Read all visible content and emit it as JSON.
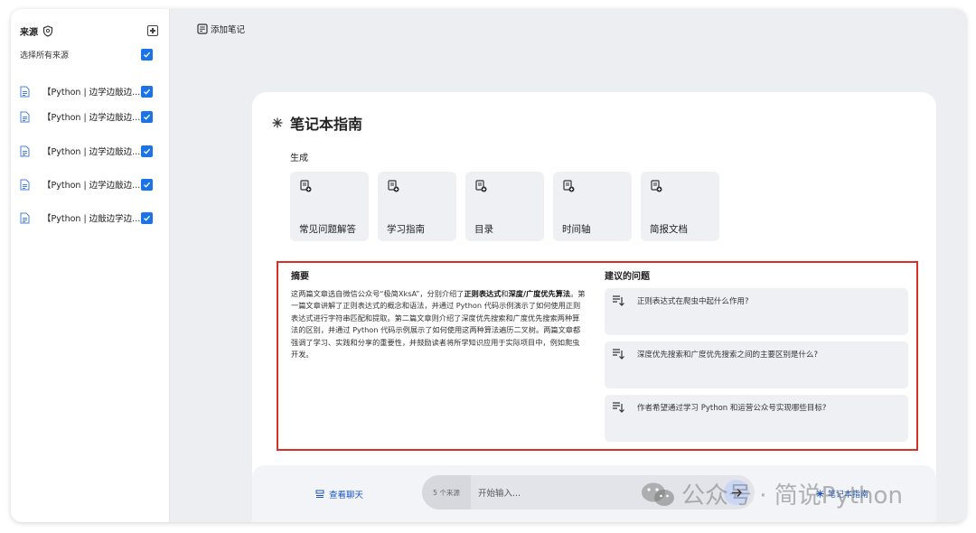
{
  "sidebar": {
    "title": "来源",
    "select_all": "选择所有来源",
    "sources": [
      {
        "name": "【Python | 边学边敲边..."
      },
      {
        "name": "【Python | 边学边敲边..."
      },
      {
        "name": "【Python | 边学边敲边..."
      },
      {
        "name": "【Python | 边学边敲边..."
      },
      {
        "name": "【Python | 边敲边学边..."
      }
    ]
  },
  "main": {
    "add_note": "添加笔记",
    "guide_title": "笔记本指南",
    "generate_label": "生成",
    "generate_buttons": [
      {
        "label": "常见问题解答"
      },
      {
        "label": "学习指南"
      },
      {
        "label": "目录"
      },
      {
        "label": "时间轴"
      },
      {
        "label": "简报文档"
      }
    ],
    "summary": {
      "title": "摘要",
      "p1": "这两篇文章选自微信公众号“极简XksA”，分别介绍了",
      "b1": "正则表达式",
      "p2": "和",
      "b2": "深度/广度优先算法",
      "p3": "。第一篇文章讲解了正则表达式的概念和语法，并通过 Python 代码示例演示了如何使用正则表达式进行字符串匹配和提取。第二篇文章则介绍了深度优先搜索和广度优先搜索两种算法的区别，并通过 Python 代码示例展示了如何使用这两种算法遍历二叉树。两篇文章都强调了学习、实践和分享的重要性，并鼓励读者将所学知识应用于实际项目中，例如爬虫开发。"
    },
    "questions": {
      "title": "建议的问题",
      "items": [
        {
          "text": "正则表达式在爬虫中起什么作用?"
        },
        {
          "text": "深度优先搜索和广度优先搜索之间的主要区别是什么?"
        },
        {
          "text": "作者希望通过学习 Python 和运营公众号实现哪些目标?"
        }
      ]
    }
  },
  "chat": {
    "view_chat": "查看聊天",
    "source_count": "5 个来源",
    "placeholder": "开始输入...",
    "guide_link": "笔记本指南"
  },
  "watermark": {
    "text": "公众号 · 简说Python"
  },
  "colors": {
    "accent": "#1a73e8",
    "highlight_border": "#d93025",
    "link": "#1a55c4"
  }
}
